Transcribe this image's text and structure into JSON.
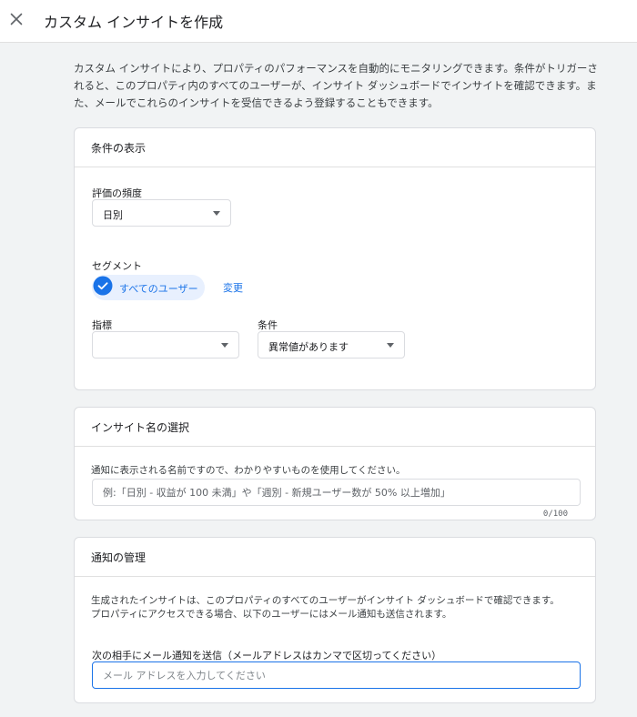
{
  "header": {
    "title": "カスタム インサイトを作成",
    "close_icon": "close-icon"
  },
  "intro": "カスタム インサイトにより、プロパティのパフォーマンスを自動的にモニタリングできます。条件がトリガーされると、このプロパティ内のすべてのユーザーが、インサイト ダッシュボードでインサイトを確認できます。また、メールでこれらのインサイトを受信できるよう登録することもできます。",
  "conditions": {
    "title": "条件の表示",
    "frequency_label": "評価の頻度",
    "frequency_value": "日別",
    "segment_label": "セグメント",
    "segment_chip": "すべてのユーザー",
    "segment_change": "変更",
    "metric_label": "指標",
    "metric_value": "",
    "condition_label": "条件",
    "condition_value": "異常値があります"
  },
  "insight_name": {
    "title": "インサイト名の選択",
    "description": "通知に表示される名前ですので、わかりやすいものを使用してください。",
    "placeholder": "例:「日別 - 収益が 100 未満」や「週別 - 新規ユーザー数が 50% 以上増加」",
    "value": "",
    "counter": "0/100"
  },
  "notifications": {
    "title": "通知の管理",
    "description_line1": "生成されたインサイトは、このプロパティのすべてのユーザーがインサイト ダッシュボードで確認できます。",
    "description_line2": "プロパティにアクセスできる場合、以下のユーザーにはメール通知も送信されます。",
    "email_label": "次の相手にメール通知を送信（メールアドレスはカンマで区切ってください）",
    "email_placeholder": "メール アドレスを入力してください",
    "email_value": ""
  },
  "colors": {
    "accent": "#1a73e8",
    "chip_bg": "#e8f0fe",
    "page_bg": "#f1f3f4"
  }
}
